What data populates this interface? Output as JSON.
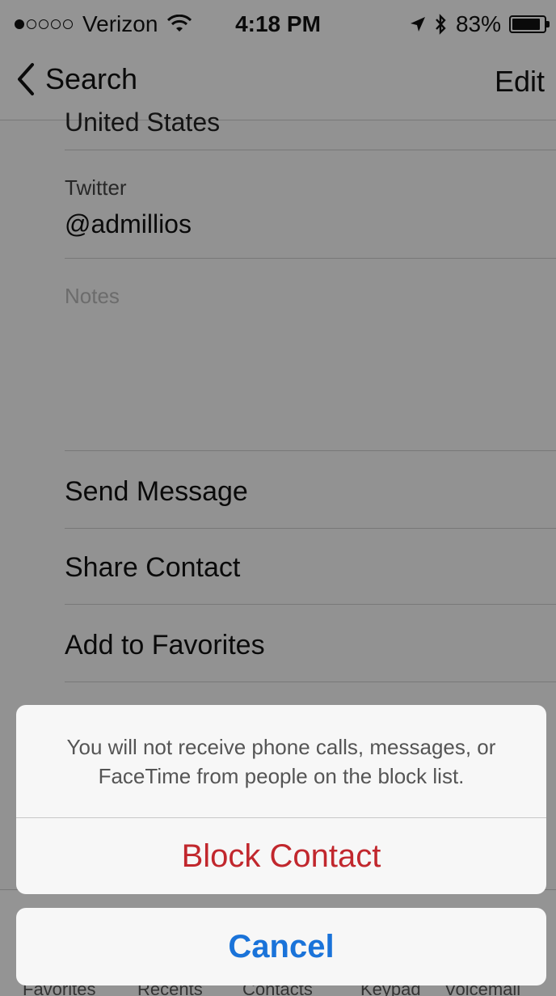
{
  "status_bar": {
    "carrier": "Verizon",
    "time": "4:18 PM",
    "battery": "83%",
    "signal_filled": 1,
    "signal_total": 5,
    "icons": [
      "wifi-icon",
      "location-arrow-icon",
      "bluetooth-icon",
      "battery-icon"
    ]
  },
  "nav": {
    "back_label": "Search",
    "edit_label": "Edit",
    "back_icon": "chevron-left-icon"
  },
  "contact": {
    "country_partial": "United States",
    "twitter_label": "Twitter",
    "twitter_value": "@admillios",
    "notes_placeholder": "Notes"
  },
  "actions": {
    "send_message": "Send Message",
    "share_contact": "Share Contact",
    "add_favorites": "Add to Favorites"
  },
  "tab_bar": {
    "items": [
      "Favorites",
      "Recents",
      "Contacts",
      "Keypad",
      "Voicemail"
    ]
  },
  "action_sheet": {
    "message": "You will not receive phone calls, messages, or FaceTime from people on the block list.",
    "block_label": "Block Contact",
    "cancel_label": "Cancel"
  },
  "colors": {
    "destructive": "#c1272d",
    "accent": "#1a73d9",
    "overlay": "rgba(0,0,0,0.40)"
  }
}
